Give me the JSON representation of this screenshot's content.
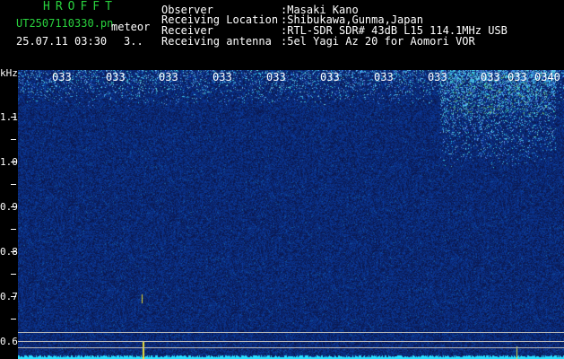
{
  "header": {
    "title": "HROFFT",
    "filename": "UT2507110330.pn",
    "mode": "meteor",
    "datetime": "25.07.11 03:30",
    "count": "3..",
    "fields": [
      {
        "label": "Observer",
        "value": ":Masaki Kano"
      },
      {
        "label": "Receiving Location",
        "value": ":Shibukawa,Gunma,Japan"
      },
      {
        "label": "Receiver",
        "value": ":RTL-SDR SDR# 43dB L15 114.1MHz USB"
      },
      {
        "label": "Receiving antenna",
        "value": ":5el Yagi Az 20 for Aomori VOR"
      }
    ]
  },
  "axis": {
    "unit": "kHz",
    "y_ticks": [
      "1.1",
      "1.0",
      "0.9",
      "0.8",
      "0.7",
      "0.6"
    ],
    "time_labels": [
      "033",
      "033",
      "033",
      "033",
      "033",
      "033",
      "033",
      "033",
      "033",
      "033",
      "0340"
    ]
  },
  "colors": {
    "header_green": "#29d13e",
    "text": "#ffffff",
    "background": "#0b1a5a",
    "baseline": "#29e0ff"
  }
}
